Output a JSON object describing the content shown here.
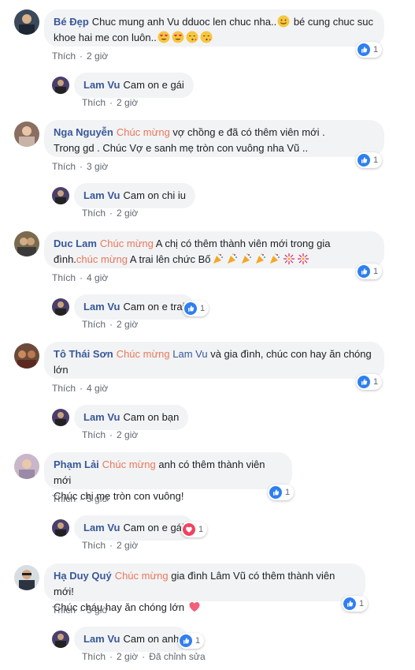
{
  "like_label": "Thích",
  "edited_label": "Đã chỉnh sửa",
  "reply_author": "Lam Vu",
  "comments": [
    {
      "author": "Bé Đẹp",
      "text1": "Chuc mung anh Vu dduoc len chuc nha..",
      "text2": " bé cung chuc suc",
      "text3": "khoe hai me con luôn..",
      "time": "2 giờ",
      "reactions": "1",
      "reply": {
        "text": "Cam on e gái",
        "time": "2 giờ"
      }
    },
    {
      "author": "Nga Nguyễn",
      "mention": "Chúc mừng",
      "text1": " vợ chồng e đã có thêm viên mới .",
      "text2": "Trong gd . Chúc Vợ e sanh mẹ tròn con vuông nha Vũ ..",
      "time": "3 giờ",
      "reactions": "1",
      "reply": {
        "text": "Cam on chi iu",
        "time": "2 giờ"
      }
    },
    {
      "author": "Duc Lam",
      "mention": "Chúc mừng",
      "text1": " A chị có thêm thành viên mới trong gia",
      "text2a": "đình.",
      "mention_b": "chúc mừng",
      "text2b": " A trai lên chức Bố",
      "time": "4 giờ",
      "reactions": "1",
      "reply": {
        "text": "Cam on e trai",
        "time": "2 giờ",
        "reactions": "1"
      }
    },
    {
      "author": "Tô Thái Sơn",
      "mention": "Chúc mừng",
      "mention_b": "Lam Vu",
      "text1": " và gia đình, chúc con hay ăn chóng",
      "text2": "lớn",
      "time": "4 giờ",
      "reactions": "1",
      "reply": {
        "text": "Cam on bạn",
        "time": "2 giờ"
      }
    },
    {
      "author": "Phạm Lải",
      "mention": "Chúc mừng",
      "text1": " anh có thêm thành viên mới",
      "text2": "Chúc chị mẹ tròn con vuông!",
      "time": "5 giờ",
      "reactions": "1",
      "reply": {
        "text": "Cam on e gái",
        "time": "2 giờ",
        "reactions": "1"
      }
    },
    {
      "author": "Hạ Duy Quý",
      "mention": "Chúc mừng",
      "text1": " gia đình Lâm Vũ có thêm thành viên mới!",
      "text2": "Chúc cháu hay ăn chóng lớn ",
      "time": "5 giờ",
      "reactions": "1",
      "reply": {
        "text": "Cam on anh",
        "time": "2 giờ",
        "reactions": "1"
      }
    }
  ]
}
